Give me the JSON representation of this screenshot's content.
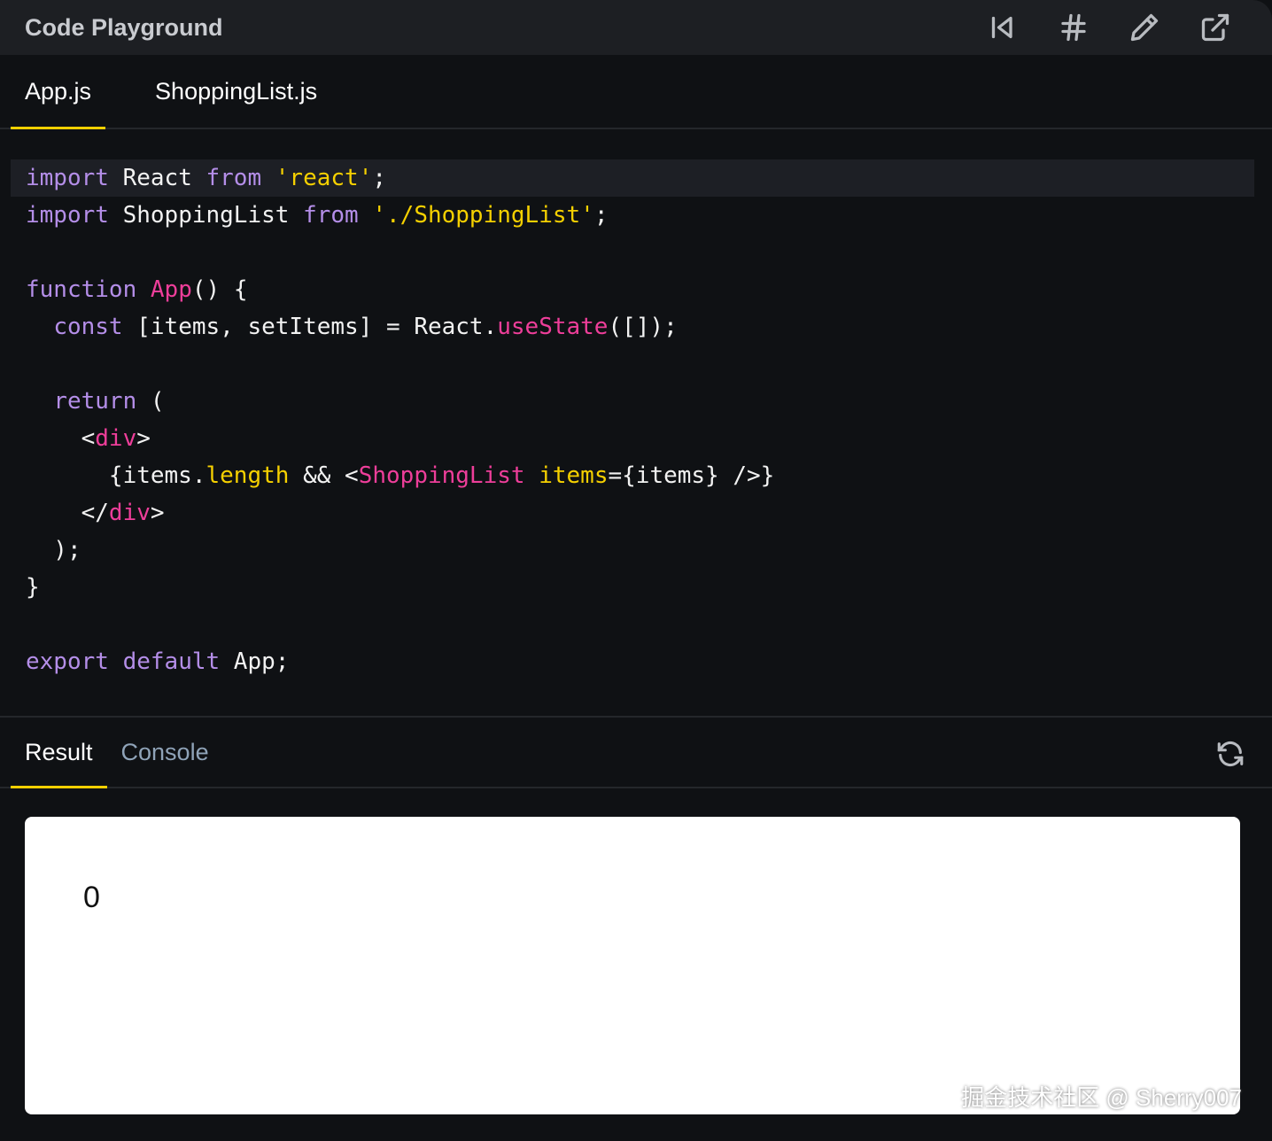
{
  "header": {
    "title": "Code Playground",
    "icons": [
      "skip-back-icon",
      "hash-icon",
      "pencil-icon",
      "external-link-icon"
    ]
  },
  "file_tabs": [
    {
      "label": "App.js",
      "active": true
    },
    {
      "label": "ShoppingList.js",
      "active": false
    }
  ],
  "code": [
    "import React from 'react';",
    "import ShoppingList from './ShoppingList';",
    "",
    "function App() {",
    "  const [items, setItems] = React.useState([]);",
    "",
    "  return (",
    "    <div>",
    "      {items.length && <ShoppingList items={items} />}",
    "    </div>",
    "  );",
    "}",
    "",
    "export default App;"
  ],
  "result_tabs": [
    {
      "label": "Result",
      "active": true
    },
    {
      "label": "Console",
      "active": false
    }
  ],
  "result": {
    "output": "0"
  },
  "watermark": "掘金技术社区 @ Sherry007",
  "colors": {
    "keyword": "#b48ee8",
    "string": "#f5d000",
    "function": "#ee3e9a",
    "accent": "#f5d000"
  }
}
